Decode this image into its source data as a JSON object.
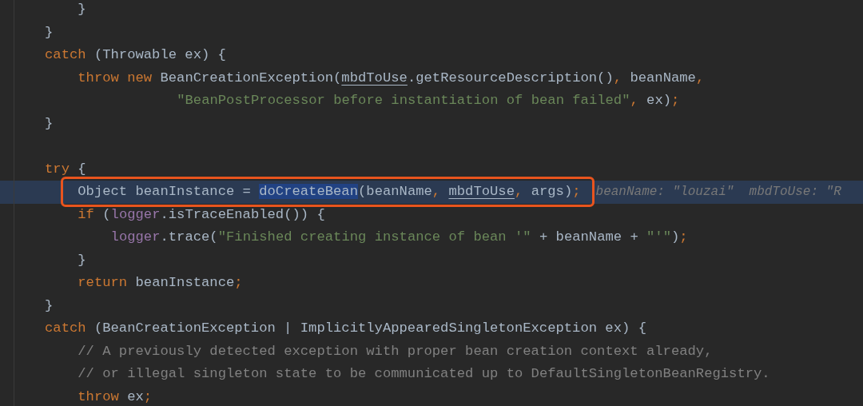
{
  "editor": {
    "lines": [
      {
        "children": [
          {
            "tokens": [
              {
                "text": "}",
                "kind": "plain"
              }
            ]
          }
        ]
      },
      {
        "tokens": [
          {
            "text": "}",
            "kind": "plain"
          }
        ]
      },
      {
        "tokens": [
          {
            "text": "catch",
            "kind": "keyword"
          },
          {
            "text": " (Throwable ex) {",
            "kind": "plain"
          }
        ],
        "children": [
          {
            "tokens": [
              {
                "text": "throw new",
                "kind": "keyword"
              },
              {
                "text": " BeanCreationException(",
                "kind": "plain"
              },
              {
                "text": "mbdToUse",
                "kind": "param"
              },
              {
                "text": ".getResourceDescription()",
                "kind": "plain"
              },
              {
                "text": ",",
                "kind": "punct"
              },
              {
                "text": " beanName",
                "kind": "plain"
              },
              {
                "text": ",",
                "kind": "punct"
              }
            ],
            "children": [
              {
                "kind": "continuation",
                "tokens": [
                  {
                    "text": "\"BeanPostProcessor before instantiation of bean failed\"",
                    "kind": "string"
                  },
                  {
                    "text": ",",
                    "kind": "punct"
                  },
                  {
                    "text": " ex)",
                    "kind": "plain"
                  },
                  {
                    "text": ";",
                    "kind": "punct"
                  }
                ]
              }
            ]
          }
        ]
      },
      {
        "tokens": [
          {
            "text": "}",
            "kind": "plain"
          }
        ]
      },
      {
        "kind": "blank"
      },
      {
        "tokens": [
          {
            "text": "try",
            "kind": "keyword"
          },
          {
            "text": " {",
            "kind": "plain"
          }
        ],
        "children": [
          {
            "current": true,
            "boxed": true,
            "tokens": [
              {
                "text": "Object beanInstance = ",
                "kind": "plain"
              },
              {
                "text": "doCreateBean",
                "kind": "selected"
              },
              {
                "text": "(beanName",
                "kind": "plain"
              },
              {
                "text": ", ",
                "kind": "punct"
              },
              {
                "text": "mbdToUse",
                "kind": "param"
              },
              {
                "text": ",",
                "kind": "punct"
              },
              {
                "text": " args)",
                "kind": "plain"
              },
              {
                "text": ";",
                "kind": "punct"
              }
            ],
            "hint": "beanName: \"louzai\"  mbdToUse: \"R"
          },
          {
            "tokens": [
              {
                "text": "if",
                "kind": "keyword"
              },
              {
                "text": " (",
                "kind": "plain"
              },
              {
                "text": "logger",
                "kind": "field"
              },
              {
                "text": ".isTraceEnabled()) {",
                "kind": "plain"
              }
            ],
            "children": [
              {
                "tokens": [
                  {
                    "text": "logger",
                    "kind": "field"
                  },
                  {
                    "text": ".trace(",
                    "kind": "plain"
                  },
                  {
                    "text": "\"Finished creating instance of bean '\"",
                    "kind": "string"
                  },
                  {
                    "text": " + beanName + ",
                    "kind": "plain"
                  },
                  {
                    "text": "\"'\"",
                    "kind": "string"
                  },
                  {
                    "text": ")",
                    "kind": "plain"
                  },
                  {
                    "text": ";",
                    "kind": "punct"
                  }
                ]
              }
            ]
          },
          {
            "tokens": [
              {
                "text": "}",
                "kind": "plain"
              }
            ]
          },
          {
            "tokens": [
              {
                "text": "return",
                "kind": "keyword"
              },
              {
                "text": " beanInstance",
                "kind": "plain"
              },
              {
                "text": ";",
                "kind": "punct"
              }
            ]
          }
        ]
      },
      {
        "tokens": [
          {
            "text": "}",
            "kind": "plain"
          }
        ]
      },
      {
        "tokens": [
          {
            "text": "catch",
            "kind": "keyword"
          },
          {
            "text": " (BeanCreationException | ImplicitlyAppearedSingletonException ex) {",
            "kind": "plain"
          }
        ],
        "children": [
          {
            "tokens": [
              {
                "text": "// A previously detected exception with proper bean creation context already,",
                "kind": "comment"
              }
            ]
          },
          {
            "tokens": [
              {
                "text": "// or illegal singleton state to be communicated up to DefaultSingletonBeanRegistry.",
                "kind": "comment"
              }
            ]
          },
          {
            "tokens": [
              {
                "text": "throw",
                "kind": "keyword"
              },
              {
                "text": " ex",
                "kind": "plain"
              },
              {
                "text": ";",
                "kind": "punct"
              }
            ]
          }
        ]
      }
    ]
  }
}
